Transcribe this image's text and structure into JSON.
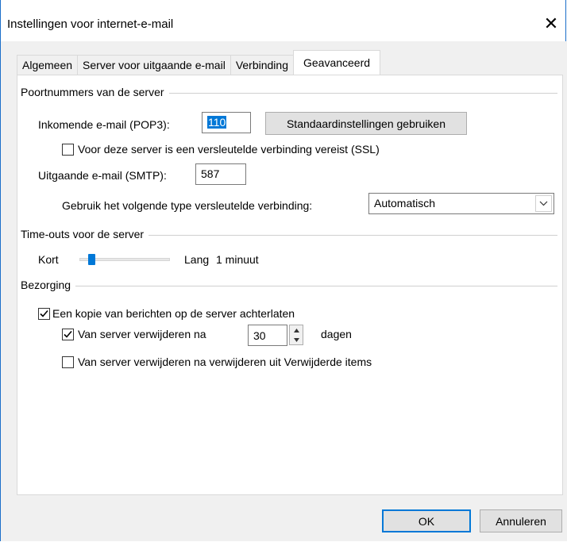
{
  "window": {
    "title": "Instellingen voor internet-e-mail"
  },
  "tabs": [
    {
      "label": "Algemeen",
      "active": false
    },
    {
      "label": "Server voor uitgaande e-mail",
      "active": false
    },
    {
      "label": "Verbinding",
      "active": false
    },
    {
      "label": "Geavanceerd",
      "active": true
    }
  ],
  "server_ports": {
    "title": "Poortnummers van de server",
    "incoming_label": "Inkomende e-mail (POP3):",
    "incoming_value": "110",
    "defaults_button": "Standaardinstellingen gebruiken",
    "ssl_checkbox_label": "Voor deze server is een versleutelde verbinding vereist (SSL)",
    "ssl_checked": false,
    "outgoing_label": "Uitgaande e-mail (SMTP):",
    "outgoing_value": "587",
    "encryption_label": "Gebruik het volgende type versleutelde verbinding:",
    "encryption_value": "Automatisch"
  },
  "timeouts": {
    "title": "Time-outs voor de server",
    "short_label": "Kort",
    "long_label": "Lang",
    "value_label": "1 minuut",
    "slider_fraction": 0.1
  },
  "delivery": {
    "title": "Bezorging",
    "leave_copy_label": "Een kopie van berichten op de server achterlaten",
    "leave_copy_checked": true,
    "remove_after_label": "Van server verwijderen na",
    "remove_after_checked": true,
    "remove_after_days": "30",
    "days_label": "dagen",
    "remove_deleted_label": "Van server verwijderen na verwijderen uit Verwijderde items",
    "remove_deleted_checked": false
  },
  "footer": {
    "ok_label": "OK",
    "cancel_label": "Annuleren"
  },
  "colors": {
    "accent": "#0078d7",
    "window_border": "#1b6fc9"
  }
}
